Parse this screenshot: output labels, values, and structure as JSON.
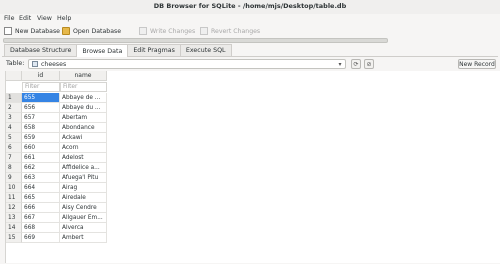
{
  "window": {
    "title": "DB Browser for SQLite - /home/mjs/Desktop/table.db"
  },
  "menu": [
    "File",
    "Edit",
    "View",
    "Help"
  ],
  "toolbar": {
    "new_database": "New Database",
    "open_database": "Open Database",
    "write_changes": "Write Changes",
    "revert_changes": "Revert Changes"
  },
  "tabs": [
    "Database Structure",
    "Browse Data",
    "Edit Pragmas",
    "Execute SQL"
  ],
  "active_tab": "Browse Data",
  "browse": {
    "table_label": "Table:",
    "table_value": "cheeses",
    "new_record": "New Record",
    "columns": [
      "id",
      "name"
    ],
    "filter_placeholder": "Filter",
    "rows": [
      {
        "n": "1",
        "id": "655",
        "name": "Abbaye de ..."
      },
      {
        "n": "2",
        "id": "656",
        "name": "Abbaye du ..."
      },
      {
        "n": "3",
        "id": "657",
        "name": "Abertam"
      },
      {
        "n": "4",
        "id": "658",
        "name": "Abondance"
      },
      {
        "n": "5",
        "id": "659",
        "name": "Ackawi"
      },
      {
        "n": "6",
        "id": "660",
        "name": "Acorn"
      },
      {
        "n": "7",
        "id": "661",
        "name": "Adelost"
      },
      {
        "n": "8",
        "id": "662",
        "name": "Affidelice a..."
      },
      {
        "n": "9",
        "id": "663",
        "name": "Afuega'l Pitu"
      },
      {
        "n": "10",
        "id": "664",
        "name": "Airag"
      },
      {
        "n": "11",
        "id": "665",
        "name": "Airedale"
      },
      {
        "n": "12",
        "id": "666",
        "name": "Aisy Cendre"
      },
      {
        "n": "13",
        "id": "667",
        "name": "Allgauer Em..."
      },
      {
        "n": "14",
        "id": "668",
        "name": "Alverca"
      },
      {
        "n": "15",
        "id": "669",
        "name": "Ambert"
      }
    ]
  },
  "colors": {
    "selection": "#3584e4"
  }
}
